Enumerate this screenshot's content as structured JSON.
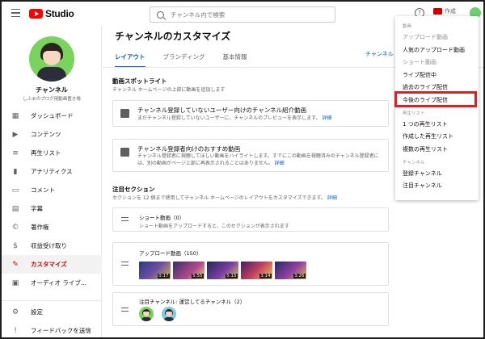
{
  "app": {
    "name": "Studio"
  },
  "search": {
    "placeholder": "チャンネル内で検索"
  },
  "header": {
    "create_label": "作成"
  },
  "channel": {
    "name": "チャンネル",
    "subtitle": "しふぁのブログ用動画置き場"
  },
  "sidebar": {
    "items": [
      {
        "label": "ダッシュボード",
        "icon": "dashboard-icon",
        "glyph": "▦"
      },
      {
        "label": "コンテンツ",
        "icon": "content-icon",
        "glyph": "▶"
      },
      {
        "label": "再生リスト",
        "icon": "playlist-icon",
        "glyph": "≡"
      },
      {
        "label": "アナリティクス",
        "icon": "analytics-icon",
        "glyph": "▮"
      },
      {
        "label": "コメント",
        "icon": "comment-icon",
        "glyph": "▭"
      },
      {
        "label": "字幕",
        "icon": "subtitles-icon",
        "glyph": "▤"
      },
      {
        "label": "著作権",
        "icon": "copyright-icon",
        "glyph": "©"
      },
      {
        "label": "収益受け取り",
        "icon": "monetization-icon",
        "glyph": "$"
      },
      {
        "label": "カスタマイズ",
        "icon": "customize-icon",
        "glyph": "✎"
      },
      {
        "label": "オーディオ ライブ...",
        "icon": "audio-library-icon",
        "glyph": "▣"
      }
    ],
    "bottom": [
      {
        "label": "設定",
        "icon": "settings-icon",
        "glyph": "⚙"
      },
      {
        "label": "フィードバックを送信",
        "icon": "feedback-icon",
        "glyph": "!"
      }
    ],
    "active_index": 8
  },
  "main": {
    "title": "チャンネルのカスタマイズ",
    "tabs": [
      {
        "label": "レイアウト"
      },
      {
        "label": "ブランディング"
      },
      {
        "label": "基本情報"
      }
    ],
    "tab_right": "チャンネル",
    "spotlight": {
      "heading": "動画スポットライト",
      "desc": "チャンネル ホームページの上部に動画を追加します",
      "cards": [
        {
          "title": "チャンネル登録していないユーザー向けのチャンネル紹介動画",
          "desc": "まだチャンネル登録していないユーザーに、チャンネルのプレビューを表示します。",
          "link": "詳細"
        },
        {
          "title": "チャンネル登録者向けのおすすめ動画",
          "desc": "チャンネル登録者に視聴してほしい動画をハイライトします。すでにこの動画を視聴済みのチャンネル登録者には、別の動画がページ上部に再表示されることはありません。",
          "link": "詳細"
        }
      ]
    },
    "featured": {
      "heading": "注目セクション",
      "desc": "セクションを 12 個まで使用してチャンネル ホームページのレイアウトをカスタマイズできます。",
      "link": "詳細",
      "shelves": [
        {
          "title": "ショート動画（0）",
          "desc": "ショート動画をアップロードすると、このセクションが表示されます"
        },
        {
          "title": "アップロード動画（150）",
          "durations": [
            "0:17",
            "5:55",
            "5:15",
            "3:14",
            "3:26"
          ]
        },
        {
          "title": "注目チャンネル: 運営してるチャンネル（2）"
        }
      ]
    }
  },
  "menu": {
    "groups": [
      {
        "heading": "動画",
        "items": [
          {
            "label": "アップロード動画",
            "disabled": true
          },
          {
            "label": "人気のアップロード動画",
            "disabled": false
          },
          {
            "label": "ショート動画",
            "disabled": true
          },
          {
            "label": "ライブ配信中",
            "disabled": false
          },
          {
            "label": "過去のライブ配信",
            "disabled": false
          },
          {
            "label": "今後のライブ配信",
            "disabled": false
          }
        ]
      },
      {
        "heading": "再生リスト",
        "items": [
          {
            "label": "1 つの再生リスト",
            "disabled": false
          },
          {
            "label": "作成した再生リスト",
            "disabled": false
          },
          {
            "label": "複数の再生リスト",
            "disabled": false
          }
        ]
      },
      {
        "heading": "チャンネル",
        "items": [
          {
            "label": "登録チャンネル",
            "disabled": false
          },
          {
            "label": "注目チャンネル",
            "disabled": false
          }
        ]
      }
    ],
    "highlighted": "今後のライブ配信"
  },
  "colors": {
    "accent": "#065fd4",
    "active": "#cc0000",
    "highlight_box": "#e02020",
    "logo_red": "#ff0000"
  }
}
